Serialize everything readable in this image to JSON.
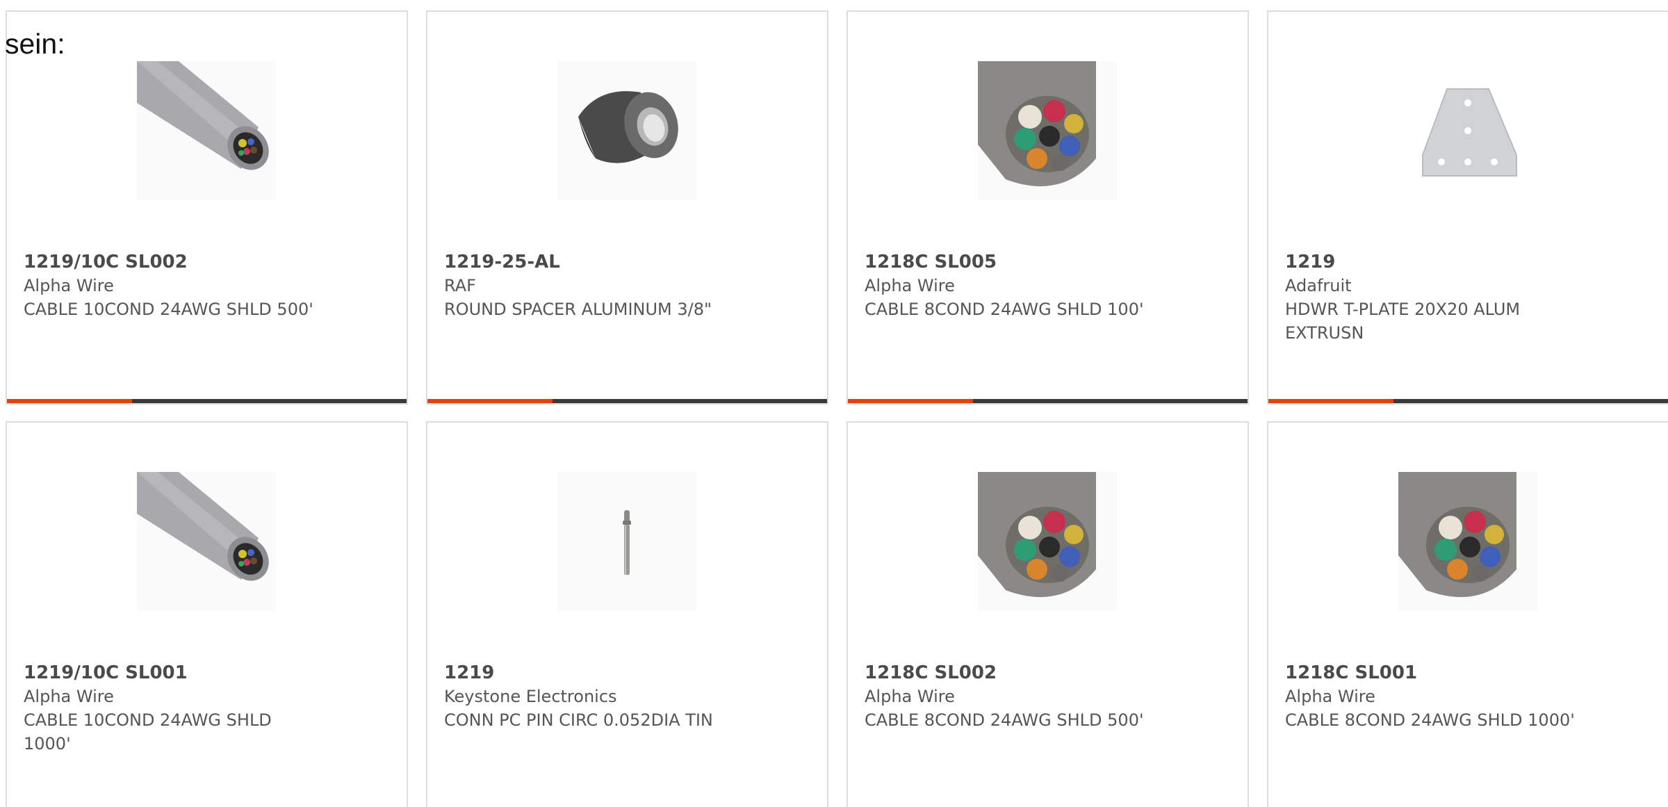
{
  "prefix_text": "sein:",
  "colors": {
    "accent": "#e2420f",
    "bar": "#3a3a3a",
    "card_border": "#dddddd",
    "text": "#555555"
  },
  "products": [
    {
      "part_number": "1219/10C SL002",
      "manufacturer": "Alpha Wire",
      "description": "CABLE 10COND 24AWG SHLD 500'",
      "icon": "gray-cable-end-icon",
      "accent_bar": true
    },
    {
      "part_number": "1219-25-AL",
      "manufacturer": "RAF",
      "description": "ROUND SPACER ALUMINUM 3/8\"",
      "icon": "round-spacer-icon",
      "accent_bar": true
    },
    {
      "part_number": "1218C SL005",
      "manufacturer": "Alpha Wire",
      "description": "CABLE 8COND 24AWG SHLD 100'",
      "icon": "multicolor-cable-end-icon",
      "accent_bar": true
    },
    {
      "part_number": "1219",
      "manufacturer": "Adafruit",
      "description": "HDWR T-PLATE 20X20 ALUM EXTRUSN",
      "icon": "t-plate-icon",
      "accent_bar": true
    },
    {
      "part_number": "1219/10C SL001",
      "manufacturer": "Alpha Wire",
      "description": "CABLE 10COND 24AWG SHLD 1000'",
      "icon": "gray-cable-end-icon",
      "accent_bar": false
    },
    {
      "part_number": "1219",
      "manufacturer": "Keystone Electronics",
      "description": "CONN PC PIN CIRC 0.052DIA TIN",
      "icon": "pc-pin-icon",
      "accent_bar": false
    },
    {
      "part_number": "1218C SL002",
      "manufacturer": "Alpha Wire",
      "description": "CABLE 8COND 24AWG SHLD 500'",
      "icon": "multicolor-cable-end-icon",
      "accent_bar": false
    },
    {
      "part_number": "1218C SL001",
      "manufacturer": "Alpha Wire",
      "description": "CABLE 8COND 24AWG SHLD 1000'",
      "icon": "multicolor-cable-end-icon",
      "accent_bar": false
    }
  ]
}
